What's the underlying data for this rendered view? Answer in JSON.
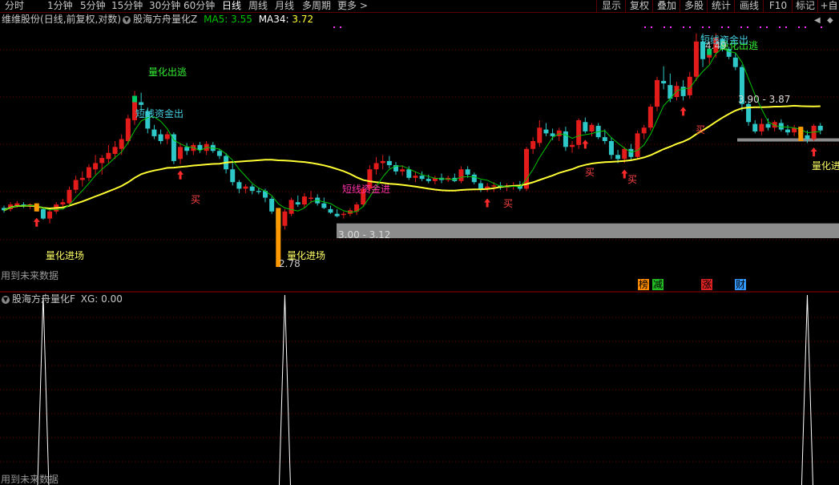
{
  "toolbar": {
    "periods": [
      "分时",
      "1分钟",
      "5分钟",
      "15分钟",
      "30分钟",
      "60分钟",
      "日线",
      "周线",
      "月线",
      "多周期",
      "更多 >"
    ],
    "active_period": "日线",
    "right_buttons": [
      "显示",
      "复权",
      "叠加",
      "多股",
      "统计",
      "画线",
      "F10",
      "标记",
      "+自"
    ]
  },
  "stock": {
    "name": "维维股份",
    "mode": "(日线,前复权,对数)",
    "indicator": "股海方舟量化Z",
    "ma5_label": "MA5:",
    "ma5_value": "3.55",
    "ma34_label": "MA34:",
    "ma34_value": "3.72"
  },
  "sub_indicator": {
    "name": "股海方舟量化F",
    "xg_label": "XG:",
    "xg_value": "0.00"
  },
  "annotations": {
    "future_data": "用到未来数据",
    "quant_out": "量化出逃",
    "short_fund_out": "短线资金出",
    "short_fund_out2": "短线资金出",
    "short_fund_in": "短线资金进",
    "quant_in": "量化进场",
    "quant_in_abbr": "量化进",
    "buy": "买",
    "price_low": "2.78",
    "price_high": "4.49",
    "zone_high": "3.90 - 3.87",
    "zone_low": "3.00 - 3.12"
  },
  "badges": [
    {
      "text": "榜",
      "color": "#ff8c00"
    },
    {
      "text": "减",
      "color": "#22bb22"
    },
    {
      "text": "涨",
      "color": "#dd2222"
    },
    {
      "text": "财",
      "color": "#3399ff"
    }
  ],
  "colors": {
    "up": "#e21b1b",
    "down": "#2fc8c8",
    "ma5": "#00c400",
    "ma34": "#ffff33",
    "grid": "#7a0000",
    "zone": "#8c8c8c",
    "signal": "#ff9900",
    "buy_arrow": "#ff2a2a",
    "out_marker": "#00cc66"
  },
  "chart_data": {
    "type": "candlestick",
    "ohlc": [
      [
        3.25,
        3.27,
        3.21,
        3.23
      ],
      [
        3.24,
        3.3,
        3.22,
        3.28
      ],
      [
        3.27,
        3.31,
        3.25,
        3.29
      ],
      [
        3.28,
        3.3,
        3.25,
        3.27
      ],
      [
        3.26,
        3.29,
        3.24,
        3.28
      ],
      [
        3.27,
        3.29,
        3.22,
        3.24
      ],
      [
        3.24,
        3.25,
        3.15,
        3.16
      ],
      [
        3.16,
        3.25,
        3.12,
        3.22
      ],
      [
        3.22,
        3.3,
        3.2,
        3.28
      ],
      [
        3.28,
        3.33,
        3.24,
        3.3
      ],
      [
        3.29,
        3.44,
        3.27,
        3.41
      ],
      [
        3.41,
        3.54,
        3.38,
        3.5
      ],
      [
        3.5,
        3.58,
        3.44,
        3.52
      ],
      [
        3.52,
        3.65,
        3.49,
        3.62
      ],
      [
        3.6,
        3.74,
        3.55,
        3.66
      ],
      [
        3.66,
        3.74,
        3.55,
        3.71
      ],
      [
        3.7,
        3.84,
        3.66,
        3.76
      ],
      [
        3.75,
        3.88,
        3.7,
        3.82
      ],
      [
        3.8,
        3.95,
        3.74,
        3.9
      ],
      [
        3.88,
        4.16,
        3.85,
        4.12
      ],
      [
        4.1,
        4.43,
        4.05,
        4.35
      ],
      [
        4.3,
        4.41,
        4.2,
        4.27
      ],
      [
        4.2,
        4.24,
        3.96,
        4.01
      ],
      [
        4.0,
        4.05,
        3.9,
        3.93
      ],
      [
        3.95,
        4.0,
        3.85,
        3.88
      ],
      [
        3.9,
        3.98,
        3.85,
        3.95
      ],
      [
        3.95,
        3.97,
        3.65,
        3.68
      ],
      [
        3.7,
        3.86,
        3.65,
        3.82
      ],
      [
        3.82,
        3.86,
        3.74,
        3.78
      ],
      [
        3.78,
        3.86,
        3.74,
        3.84
      ],
      [
        3.84,
        3.87,
        3.76,
        3.79
      ],
      [
        3.78,
        3.88,
        3.74,
        3.85
      ],
      [
        3.84,
        3.87,
        3.76,
        3.78
      ],
      [
        3.78,
        3.8,
        3.7,
        3.73
      ],
      [
        3.73,
        3.76,
        3.56,
        3.6
      ],
      [
        3.6,
        3.66,
        3.45,
        3.48
      ],
      [
        3.48,
        3.5,
        3.38,
        3.42
      ],
      [
        3.42,
        3.46,
        3.38,
        3.44
      ],
      [
        3.44,
        3.46,
        3.37,
        3.4
      ],
      [
        3.4,
        3.43,
        3.37,
        3.39
      ],
      [
        3.4,
        3.42,
        3.3,
        3.34
      ],
      [
        3.33,
        3.35,
        3.2,
        3.22
      ],
      [
        3.22,
        3.25,
        2.78,
        3.08
      ],
      [
        3.1,
        3.24,
        3.07,
        3.22
      ],
      [
        3.2,
        3.34,
        3.18,
        3.32
      ],
      [
        3.3,
        3.36,
        3.26,
        3.28
      ],
      [
        3.28,
        3.38,
        3.25,
        3.35
      ],
      [
        3.33,
        3.4,
        3.29,
        3.34
      ],
      [
        3.34,
        3.37,
        3.27,
        3.29
      ],
      [
        3.29,
        3.34,
        3.24,
        3.25
      ],
      [
        3.24,
        3.27,
        3.2,
        3.21
      ],
      [
        3.2,
        3.24,
        3.17,
        3.18
      ],
      [
        3.19,
        3.22,
        3.16,
        3.2
      ],
      [
        3.2,
        3.25,
        3.18,
        3.23
      ],
      [
        3.22,
        3.3,
        3.19,
        3.28
      ],
      [
        3.28,
        3.44,
        3.26,
        3.42
      ],
      [
        3.42,
        3.64,
        3.4,
        3.6
      ],
      [
        3.6,
        3.72,
        3.55,
        3.66
      ],
      [
        3.66,
        3.74,
        3.6,
        3.68
      ],
      [
        3.68,
        3.73,
        3.61,
        3.64
      ],
      [
        3.64,
        3.67,
        3.55,
        3.58
      ],
      [
        3.58,
        3.64,
        3.54,
        3.6
      ],
      [
        3.6,
        3.63,
        3.5,
        3.52
      ],
      [
        3.52,
        3.58,
        3.48,
        3.54
      ],
      [
        3.54,
        3.58,
        3.49,
        3.51
      ],
      [
        3.51,
        3.55,
        3.47,
        3.49
      ],
      [
        3.49,
        3.54,
        3.46,
        3.52
      ],
      [
        3.52,
        3.56,
        3.47,
        3.5
      ],
      [
        3.5,
        3.54,
        3.48,
        3.52
      ],
      [
        3.52,
        3.56,
        3.48,
        3.49
      ],
      [
        3.49,
        3.63,
        3.47,
        3.6
      ],
      [
        3.6,
        3.63,
        3.52,
        3.55
      ],
      [
        3.55,
        3.57,
        3.46,
        3.48
      ],
      [
        3.47,
        3.5,
        3.39,
        3.42
      ],
      [
        3.42,
        3.47,
        3.39,
        3.44
      ],
      [
        3.44,
        3.48,
        3.39,
        3.45
      ],
      [
        3.45,
        3.48,
        3.41,
        3.43
      ],
      [
        3.43,
        3.47,
        3.4,
        3.44
      ],
      [
        3.44,
        3.48,
        3.41,
        3.45
      ],
      [
        3.45,
        3.49,
        3.4,
        3.42
      ],
      [
        3.42,
        3.82,
        3.4,
        3.8
      ],
      [
        3.8,
        3.92,
        3.75,
        3.88
      ],
      [
        3.86,
        4.1,
        3.82,
        4.02
      ],
      [
        4.0,
        4.07,
        3.93,
        3.96
      ],
      [
        3.96,
        4.01,
        3.89,
        3.93
      ],
      [
        3.93,
        4.02,
        3.88,
        3.99
      ],
      [
        3.98,
        4.03,
        3.78,
        3.82
      ],
      [
        3.82,
        3.88,
        3.76,
        3.84
      ],
      [
        3.84,
        4.12,
        3.8,
        4.1
      ],
      [
        4.08,
        4.13,
        3.96,
        3.98
      ],
      [
        3.98,
        4.07,
        3.93,
        4.05
      ],
      [
        4.04,
        4.07,
        3.9,
        3.92
      ],
      [
        3.92,
        4.0,
        3.85,
        3.88
      ],
      [
        3.88,
        3.92,
        3.7,
        3.74
      ],
      [
        3.74,
        3.79,
        3.66,
        3.7
      ],
      [
        3.7,
        3.82,
        3.66,
        3.8
      ],
      [
        3.8,
        3.85,
        3.68,
        3.72
      ],
      [
        3.72,
        3.99,
        3.7,
        3.96
      ],
      [
        3.96,
        4.05,
        3.9,
        4.02
      ],
      [
        4.02,
        4.28,
        3.99,
        4.25
      ],
      [
        4.25,
        4.6,
        4.2,
        4.56
      ],
      [
        4.55,
        4.73,
        4.45,
        4.52
      ],
      [
        4.5,
        4.64,
        4.3,
        4.34
      ],
      [
        4.36,
        4.54,
        4.32,
        4.49
      ],
      [
        4.48,
        4.56,
        4.32,
        4.37
      ],
      [
        4.38,
        4.66,
        4.34,
        4.6
      ],
      [
        4.6,
        5.16,
        4.55,
        5.05
      ],
      [
        5.05,
        5.16,
        4.72,
        4.82
      ],
      [
        4.84,
        5.02,
        4.76,
        4.88
      ],
      [
        4.9,
        5.16,
        4.84,
        5.1
      ],
      [
        5.08,
        5.1,
        4.92,
        4.95
      ],
      [
        4.95,
        4.98,
        4.82,
        4.85
      ],
      [
        4.84,
        4.9,
        4.68,
        4.72
      ],
      [
        4.72,
        4.75,
        4.2,
        4.28
      ],
      [
        4.28,
        4.32,
        4.04,
        4.08
      ],
      [
        4.06,
        4.1,
        3.96,
        3.98
      ],
      [
        3.98,
        4.12,
        3.94,
        4.06
      ],
      [
        4.06,
        4.12,
        3.99,
        4.02
      ],
      [
        4.02,
        4.1,
        3.98,
        4.08
      ],
      [
        4.07,
        4.11,
        3.98,
        4.0
      ],
      [
        4.0,
        4.05,
        3.94,
        3.97
      ],
      [
        3.97,
        4.05,
        3.93,
        4.02
      ],
      [
        4.02,
        4.03,
        3.88,
        3.94
      ],
      [
        3.94,
        3.99,
        3.86,
        3.9
      ],
      [
        3.9,
        4.06,
        3.88,
        4.04
      ],
      [
        4.04,
        4.07,
        3.95,
        3.99
      ]
    ],
    "xg_signals": [
      6,
      43,
      123
    ]
  }
}
